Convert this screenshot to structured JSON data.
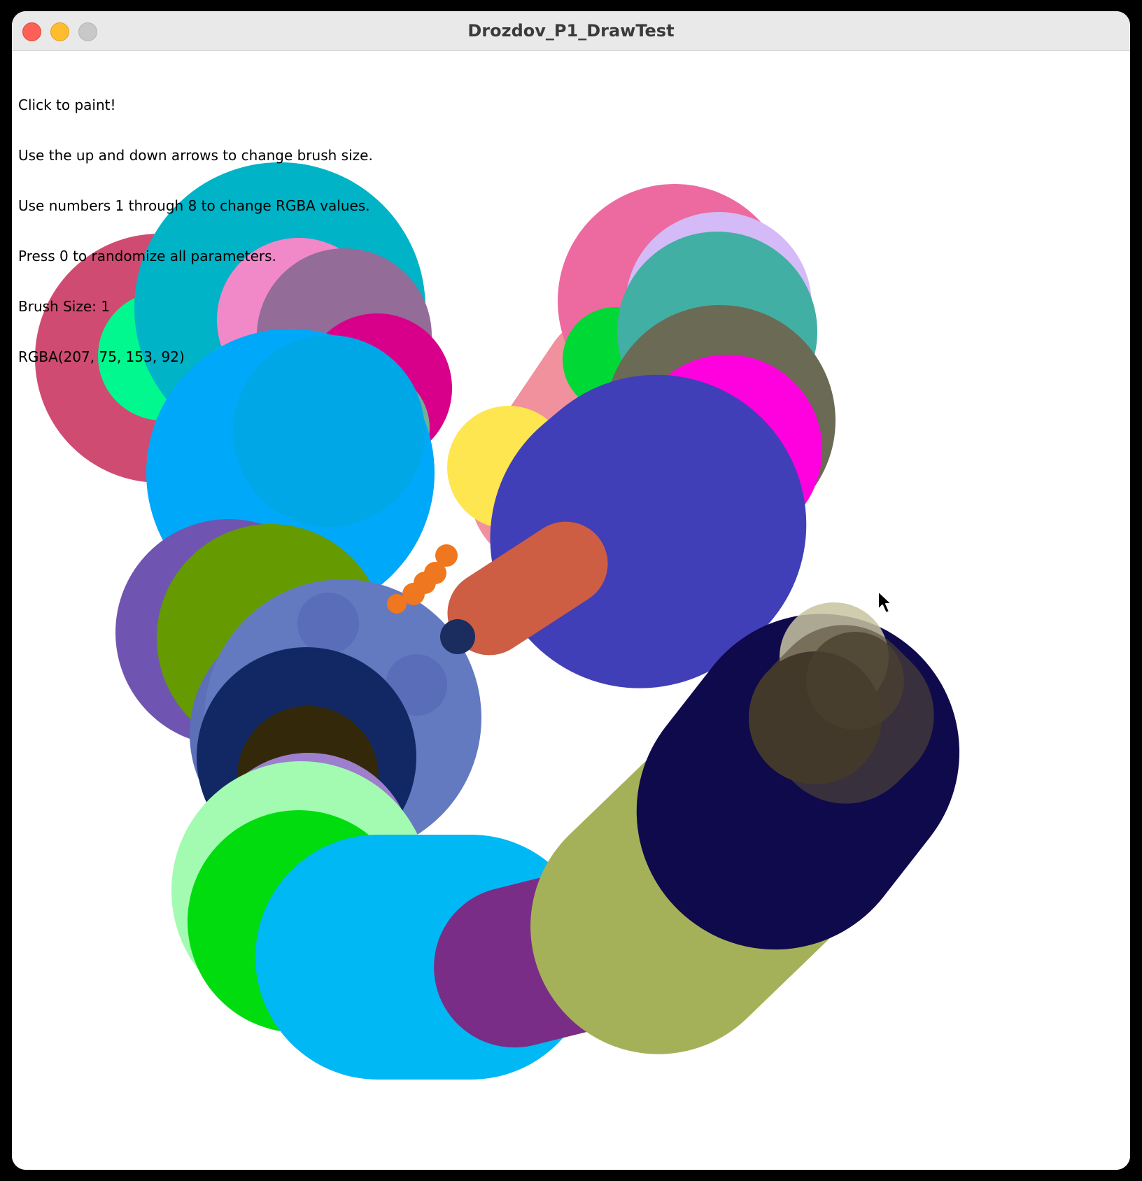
{
  "window": {
    "title": "Drozdov_P1_DrawTest"
  },
  "instructions": {
    "line1": "Click to paint!",
    "line2": "Use the up and down arrows to change brush size.",
    "line3": "Use numbers 1 through 8 to change RGBA values.",
    "line4": "Press 0 to randomize all parameters.",
    "brush_size": "Brush Size: 1",
    "rgba": "RGBA(207, 75, 153, 92)"
  },
  "colors": {
    "window_background": "#ffffff",
    "titlebar": "#e9e9e9",
    "close_button": "#fe5f57",
    "minimize_button": "#febc2e",
    "zoom_button": "#c8c8c8"
  },
  "icons": {
    "close": "close-button",
    "minimize": "minimize-button",
    "zoom": "zoom-button",
    "cursor": "arrow-pointer-icon"
  }
}
